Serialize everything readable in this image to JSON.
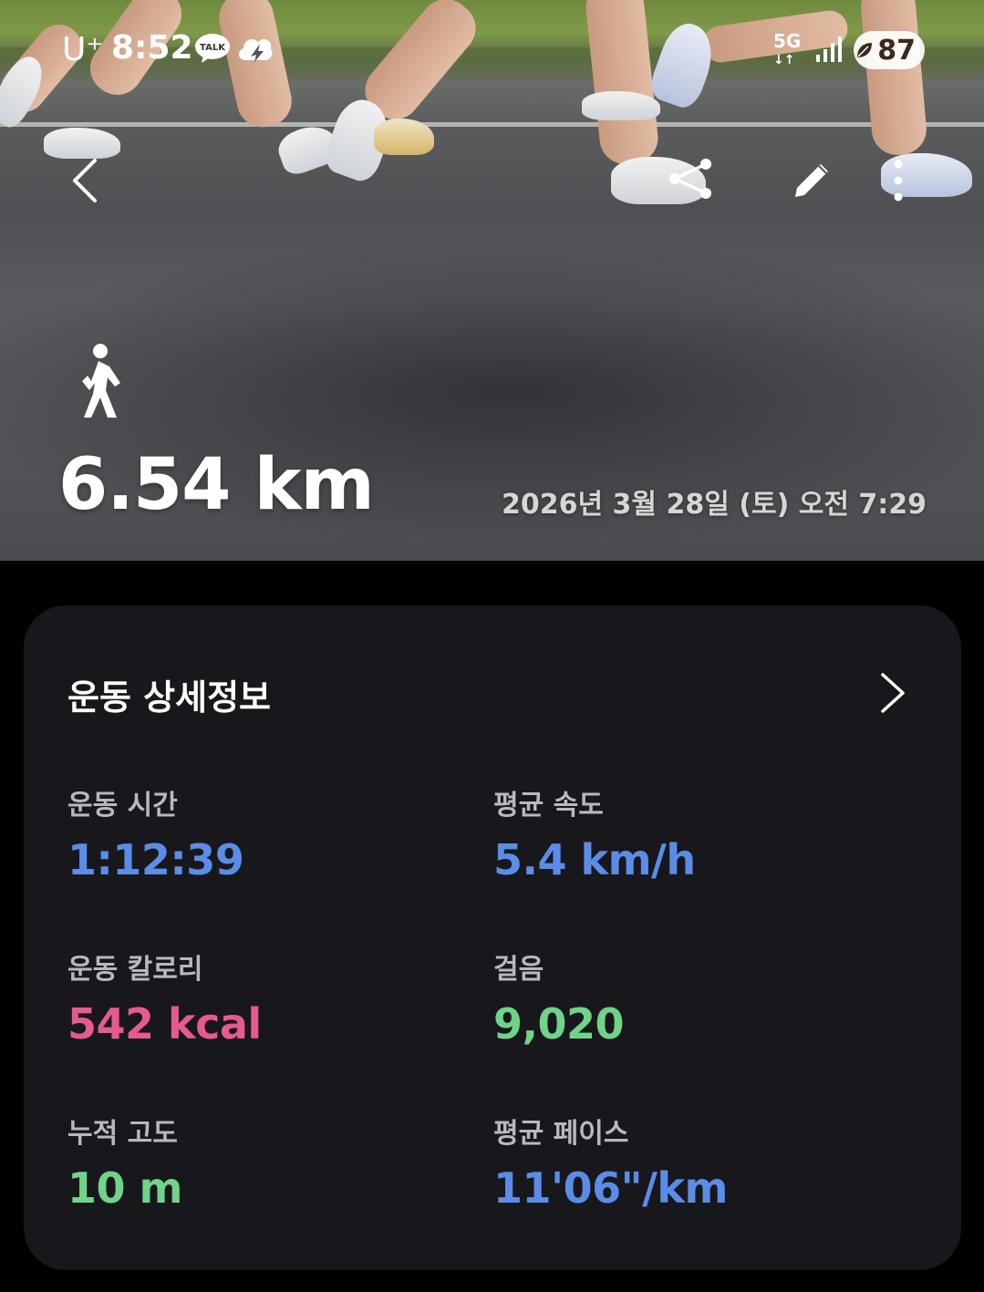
{
  "status_bar": {
    "carrier": "U⁺",
    "time": "8:52",
    "talk_label": "TALK",
    "network": "5G",
    "battery": "87"
  },
  "hero": {
    "distance": "6.54 km",
    "datetime": "2026년 3월 28일 (토) 오전 7:29"
  },
  "details": {
    "title": "운동 상세정보",
    "metrics": [
      {
        "label": "운동 시간",
        "value": "1:12:39",
        "color": "#5b8de8"
      },
      {
        "label": "평균 속도",
        "value": "5.4 km/h",
        "color": "#5b8de8"
      },
      {
        "label": "운동 칼로리",
        "value": "542 kcal",
        "color": "#e75a8f"
      },
      {
        "label": "걸음",
        "value": "9,020",
        "color": "#6fd48a"
      },
      {
        "label": "누적 고도",
        "value": "10 m",
        "color": "#6fd48a"
      },
      {
        "label": "평균 페이스",
        "value": "11'06\"/km",
        "color": "#5b8de8"
      }
    ]
  }
}
